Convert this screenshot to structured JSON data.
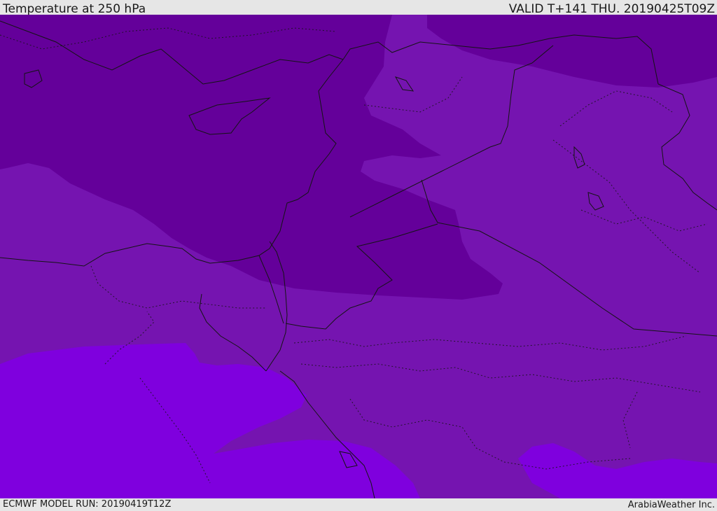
{
  "header": {
    "title": "Temperature at 250 hPa",
    "valid": "VALID T+141 THU. 20190425T09Z"
  },
  "footer": {
    "model_run": "ECMWF MODEL RUN: 20190419T12Z",
    "credit": "ArabiaWeather Inc."
  },
  "colors": {
    "band_coldest": "#64009a",
    "band_mid": "#7514b0",
    "band_warm": "#7f00de",
    "coast": "#141414",
    "bar": "#e6e6e6"
  }
}
